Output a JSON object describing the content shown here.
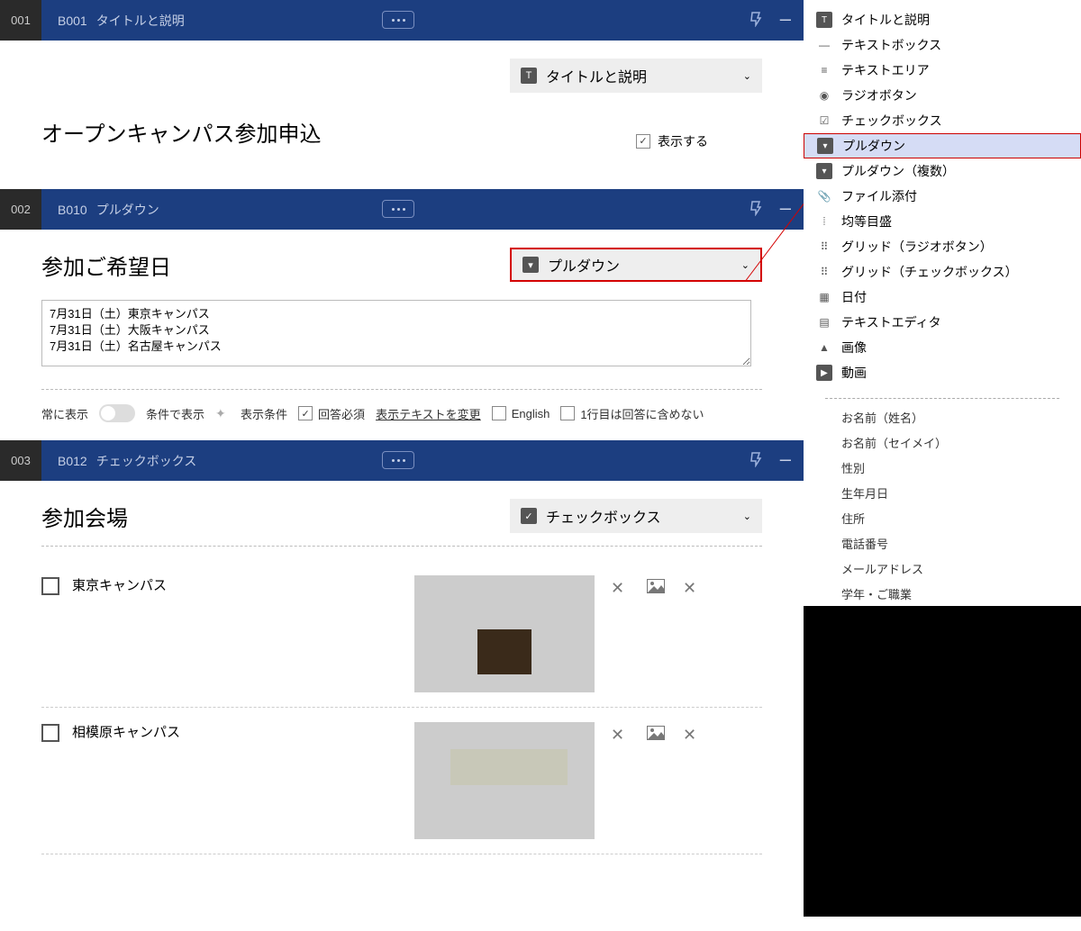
{
  "blocks": [
    {
      "num": "001",
      "code": "B001",
      "title": "タイトルと説明",
      "typeLabel": "タイトルと説明",
      "sectTitle": "オープンキャンパス参加申込",
      "showLabel": "表示する"
    },
    {
      "num": "002",
      "code": "B010",
      "title": "プルダウン",
      "typeLabel": "プルダウン",
      "sectTitle": "参加ご希望日",
      "ta": "7月31日（土）東京キャンパス\n7月31日（土）大阪キャンパス\n7月31日（土）名古屋キャンパス",
      "opts": {
        "always": "常に表示",
        "cond": "条件で表示",
        "condBtn": "表示条件",
        "required": "回答必須",
        "changeText": "表示テキストを変更",
        "english": "English",
        "exclude": "1行目は回答に含めない"
      }
    },
    {
      "num": "003",
      "code": "B012",
      "title": "チェックボックス",
      "typeLabel": "チェックボックス",
      "sectTitle": "参加会場",
      "items": [
        {
          "label": "東京キャンパス"
        },
        {
          "label": "相模原キャンパス"
        }
      ]
    }
  ],
  "side": {
    "types": [
      {
        "icon": "T",
        "label": "タイトルと説明"
      },
      {
        "icon": "—",
        "label": "テキストボックス"
      },
      {
        "icon": "≡",
        "label": "テキストエリア"
      },
      {
        "icon": "◉",
        "label": "ラジオボタン"
      },
      {
        "icon": "☑",
        "label": "チェックボックス"
      },
      {
        "icon": "▾",
        "label": "プルダウン",
        "active": true
      },
      {
        "icon": "▾",
        "label": "プルダウン（複数）"
      },
      {
        "icon": "📎",
        "label": "ファイル添付"
      },
      {
        "icon": "⦙",
        "label": "均等目盛"
      },
      {
        "icon": "⠿",
        "label": "グリッド（ラジオボタン）"
      },
      {
        "icon": "⠿",
        "label": "グリッド（チェックボックス）"
      },
      {
        "icon": "▦",
        "label": "日付"
      },
      {
        "icon": "▤",
        "label": "テキストエディタ"
      },
      {
        "icon": "▲",
        "label": "画像"
      },
      {
        "icon": "▶",
        "label": "動画"
      }
    ],
    "presets": [
      "お名前（姓名）",
      "お名前（セイメイ）",
      "性別",
      "生年月日",
      "住所",
      "電話番号",
      "メールアドレス",
      "学年・ご職業"
    ]
  }
}
